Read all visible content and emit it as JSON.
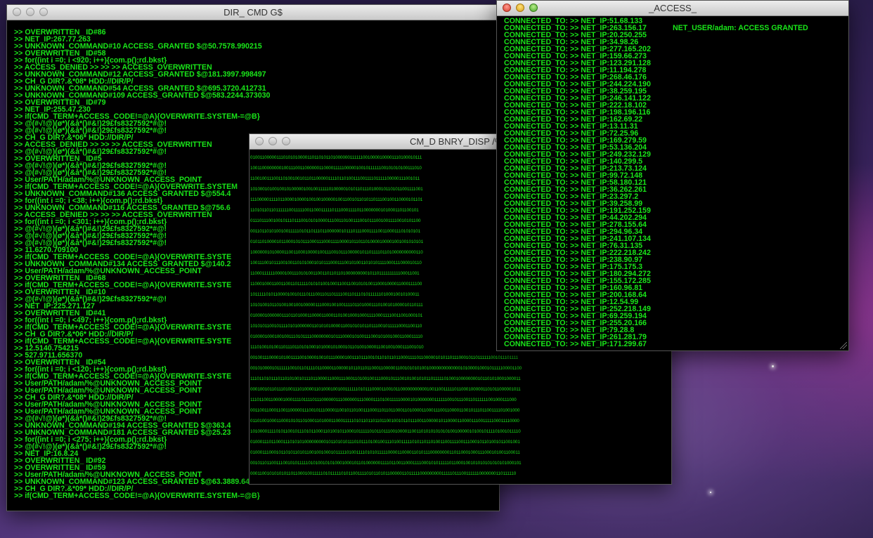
{
  "windows": {
    "dir": {
      "title": "DIR_ CMD G$",
      "lines": [
        ">> OVERWRITTEN_ ID#86",
        ">> NET_IP:267.77.263",
        ">> UNKNOWN_COMMAND#10 ACCESS_GRANTED $@50.7578.990215",
        ">> OVERWRITTEN_ ID#58",
        ">> for((int i =0; i <920; i++){com.p();rd.bkst}",
        ">> ACCESS_DENIED >> >> >> ACCESS_OVERWRITTEN",
        ">> UNKNOWN_COMMAND#12 ACCESS_GRANTED $@181.3997.998497",
        ">> CH_G DIR?.&*08* HDD://DIR/P/",
        ">> UNKNOWN_COMMAND#54 ACCESS_GRANTED $@695.3720.412731",
        ">> UNKNOWN_COMMAND#109 ACCESS_GRANTED $@583.2244.373030",
        ">> OVERWRITTEN_ ID#79",
        ">> NET_IP:255.47.230",
        ">> if(CMD_TERM+ACCESS_CODE!=@A){OVERWRITE.SYSTEM-=@B}",
        ">> @(#√!@)(ø*)(&å*()#&!)29£fs8327592*#@!",
        ">> @(#√!@)(ø*)(&å*()#&!)29£fs8327592*#@!",
        ">> CH_G DIR?.&*06* HDD://DIR/P/",
        ">> ACCESS_DENIED >> >> >> ACCESS_OVERWRITTEN",
        ">> @(#√!@)(ø*)(&å*()#&!)29£fs8327592*#@!",
        ">> OVERWRITTEN_ ID#5",
        ">> @(#√!@)(ø*)(&å*()#&!)29£fs8327592*#@!",
        ">> @(#√!@)(ø*)(&å*()#&!)29£fs8327592*#@!",
        ">> User/PATH/adam/%@UNKNOWN_ACCESS_POINT",
        ">> if(CMD_TERM+ACCESS_CODE!=@A){OVERWRITE.SYSTEM",
        ">> UNKNOWN_COMMAND#136 ACCESS_GRANTED $@554.4",
        ">> for((int i =0; i <38; i++){com.p();rd.bkst}",
        ">> UNKNOWN_COMMAND#116 ACCESS_GRANTED $@756.6",
        ">> ACCESS_DENIED >> >> >> ACCESS_OVERWRITTEN",
        ">> for((int i =0; i <301; i++){com.p();rd.bkst}",
        ">> @(#√!@)(ø*)(&å*()#&!)29£fs8327592*#@!",
        ">> @(#√!@)(ø*)(&å*()#&!)29£fs8327592*#@!",
        ">> @(#√!@)(ø*)(&å*()#&!)29£fs8327592*#@!",
        ">> 11.6270.709100",
        ">> if(CMD_TERM+ACCESS_CODE!=@A){OVERWRITE.SYSTE",
        ">> UNKNOWN_COMMAND#134 ACCESS_GRANTED $@140.2",
        ">> User/PATH/adam/%@UNKNOWN_ACCESS_POINT",
        ">> OVERWRITTEN_ ID#68",
        ">> if(CMD_TERM+ACCESS_CODE!=@A){OVERWRITE.SYSTE",
        ">> OVERWRITTEN_ ID#10",
        ">> @(#√!@)(ø*)(&å*()#&!)29£fs8327592*#@!",
        ">> NET_IP:225.271.127",
        ">> OVERWRITTEN_ ID#41",
        ">> for((int i =0; i <497; i++){com.p();rd.bkst}",
        ">> if(CMD_TERM+ACCESS_CODE!=@A){OVERWRITE.SYSTE",
        ">> CH_G DIR?.&*06* HDD://DIR/P/",
        ">> if(CMD_TERM+ACCESS_CODE!=@A){OVERWRITE.SYSTE",
        ">> 12.5140.754215",
        ">> 527.9711.656370",
        ">> OVERWRITTEN_ ID#54",
        ">> for((int i =0; i <120; i++){com.p();rd.bkst}",
        ">> if(CMD_TERM+ACCESS_CODE!=@A){OVERWRITE.SYSTE",
        ">> User/PATH/adam/%@UNKNOWN_ACCESS_POINT",
        ">> User/PATH/adam/%@UNKNOWN_ACCESS_POINT",
        ">> CH_G DIR?.&*08* HDD://DIR/P/",
        ">> User/PATH/adam/%@UNKNOWN_ACCESS_POINT",
        ">> User/PATH/adam/%@UNKNOWN_ACCESS_POINT",
        ">> @(#√!@)(ø*)(&å*()#&!)29£fs8327592*#@!",
        ">> UNKNOWN_COMMAND#194 ACCESS_GRANTED $@363.4",
        ">> UNKNOWN_COMMAND#181 ACCESS_GRANTED $@25.23",
        ">> for((int i =0; i <275; i++){com.p();rd.bkst}",
        ">> @(#√!@)(ø*)(&å*()#&!)29£fs8327592*#@!",
        ">> NET_IP:16.8.24",
        ">> OVERWRITTEN_ ID#92",
        ">> OVERWRITTEN_ ID#59",
        ">> User/PATH/adam/%@UNKNOWN_ACCESS_POINT",
        ">> UNKNOWN_COMMAND#123 ACCESS_GRANTED $@63.3889.643591",
        ">> CH_G DIR?.&*09* HDD://DIR/P/",
        ">> if(CMD_TERM+ACCESS_CODE!=@A){OVERWRITE.SYSTEM-=@B}"
      ]
    },
    "binary": {
      "title": "CM_D BNRY_DISP /%",
      "rows": [
        "0100110000011101010100001101101011010000001111110010000100001110100010111",
        "1001100000000100111001100000011000011111000001001011111100101010100111010",
        "1100100111001101001001011011000001111011010011100111101111100000111001011",
        "1010001010010010100000100100111110100000101011011101000101101011001111001",
        "1110000011110110000100001001001000001001100101101011011100100110000101101",
        "1101011011011111100111110011000111110111000111101100000001010001101100101",
        "0111011100100101110111001010100001110011010011100101110010011110010101100",
        "0011011010100100111110101101110110000001011101110001111001100011101010101",
        "0101101000010110001010111000111000111100001011011010000100001001001010101",
        "1000000101000011001100010000100111001011100000101101111011010000000000110",
        "1001110010111001001101010001010111000111001010011010101111000111000010110",
        "1100011111100001001110101001100110110110100000000010110111111111100011001",
        "1100010001100110011011111010101001000110011001010100110001000011000111100",
        "1011111010110000100101110111001101101111001101110101111110100010010100011",
        "1010100101101001001001000001110001001001111011010001110100101000010110111",
        "0100001000000111011010001100001100011010010001000111100011110011001000101",
        "1010101100101111010100000011010101000011001010101101110010111110001100110",
        "0100001000100100111010111100000000101110000101001110001010010001100011110",
        "1110100101001101110110101000101000101000101101001000011001001000111001010",
        "0010011100001010011110010000100101110000100111011100101101011011000111101100000101011011100010110111111001011101111",
        "0010100001011111100101101111011000011000001011011011000110000011001010101001000000000000010100001000101111100001100",
        "1110110101110110101001011101100001100011100011010010011100010111001010010101101111101000100000000101101010001000011",
        "0001001011011101001110100001101000100100111111010111000011001011000000000001001100111110110001000001101011000001011",
        "1110110011000010001111011110111000000111000000111000011101001111100001010000000111111001011100110111111001000111000",
        "0011001100011001100000111001011100001100101101001110001101101100011010000110001110011000011001011101100111101001000",
        "0110100100011000101011010001101000110001111101011011011011001001011011100110000010110000110000111001111100011110000",
        "1010000111101011001011101011000110100101100010111110101101110010000110011010101010101001000001010010111101001011110",
        "0100011101100011101010100000000010110101011101011101001001110100111110101101101001100111100111000101101001011001001",
        "0100011100010110101101011001001000101111101001111010101111100001100001101011100000000110110001000111000101001100011",
        "0010110110011100101011111010100101010001000101101000000111101100110001111000101011111011000100101010101010101000101",
        "0001100101010101101100010011111010111110101100111101011010110000011011111000000000111110111001111110000000110111110"
      ]
    },
    "access": {
      "title": "_ACCESS_",
      "status": "NET_USER/adam: ACCESS GRANTED",
      "prefix": "CONNECTED_TO: >> NET_IP:",
      "ips": [
        "51.68.133",
        "263.156.17",
        "20.250.255",
        "34.98.26",
        "277.165.202",
        "159.66.273",
        "123.291.128",
        "11.194.278",
        "268.46.176",
        "244.224.190",
        "38.259.195",
        "246.141.122",
        "222.18.102",
        "198.196.116",
        "162.69.22",
        "13.11.31",
        "72.25.96",
        "169.279.59",
        "53.136.204",
        "249.232.129",
        "140.299.5",
        "213.73.124",
        "99.72.148",
        "58.180.121",
        "36.262.261",
        "23.297.2",
        "39.258.99",
        "191.252.159",
        "44.202.294",
        "278.155.64",
        "294.96.34",
        "241.107.134",
        "76.31.135",
        "222.218.242",
        "238.90.97",
        "175.175.3",
        "180.294.272",
        "155.172.285",
        "160.96.81",
        "200.168.64",
        "12.54.99",
        "252.218.149",
        "69.259.194",
        "255.20.166",
        "79.28.8",
        "261.281.79",
        "171.299.67"
      ]
    }
  }
}
